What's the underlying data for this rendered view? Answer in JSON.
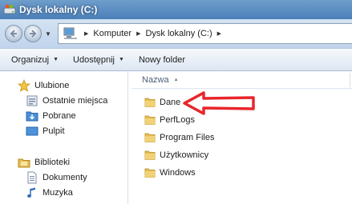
{
  "window": {
    "title": "Dysk lokalny (C:)"
  },
  "address": {
    "crumbs": [
      "Komputer",
      "Dysk lokalny (C:)"
    ]
  },
  "toolbar": {
    "organize": "Organizuj",
    "share": "Udostępnij",
    "new_folder": "Nowy folder"
  },
  "navpane": {
    "favorites_label": "Ulubione",
    "favorites": [
      "Ostatnie miejsca",
      "Pobrane",
      "Pulpit"
    ],
    "libraries_label": "Biblioteki",
    "libraries": [
      "Dokumenty",
      "Muzyka"
    ]
  },
  "content": {
    "column_name": "Nazwa",
    "files": [
      "Dane",
      "PerfLogs",
      "Program Files",
      "Użytkownicy",
      "Windows"
    ]
  },
  "colors": {
    "annotation_arrow": "#e8262a",
    "folder": "#e7be4e",
    "title_bar": "#5b8dc2"
  }
}
